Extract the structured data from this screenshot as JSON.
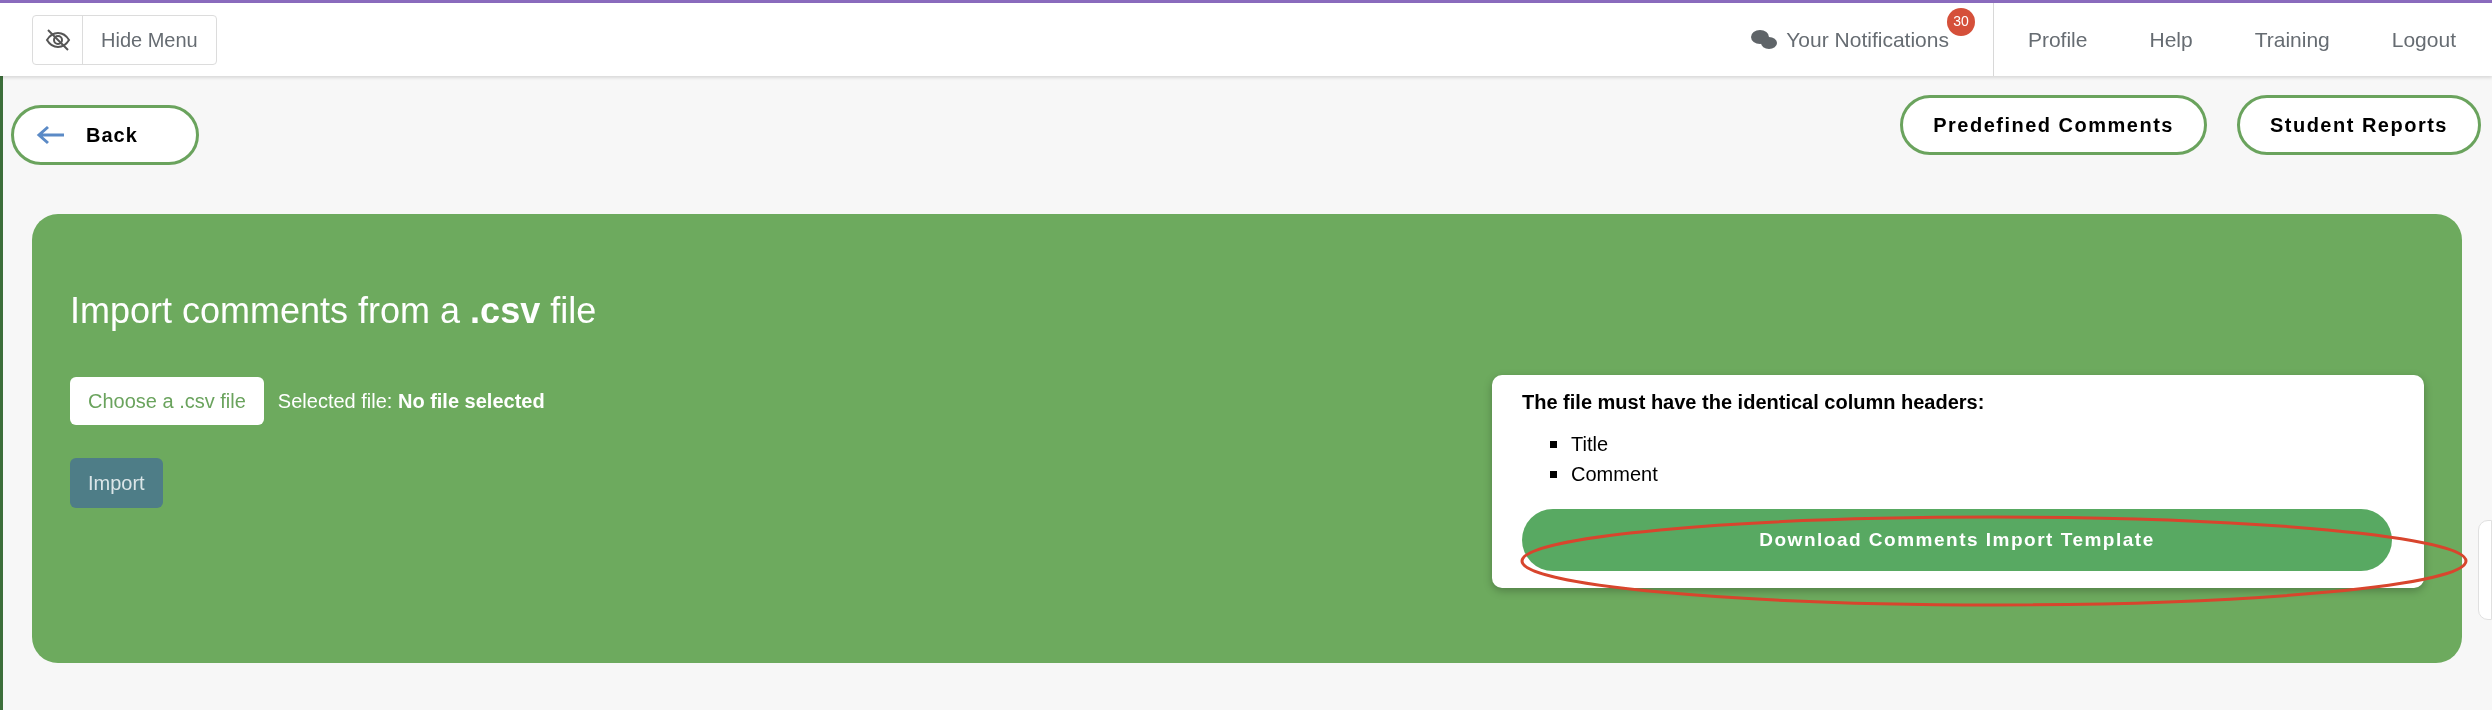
{
  "header": {
    "hide_menu": "Hide Menu",
    "notifications": {
      "label": "Your Notifications",
      "count": "30"
    },
    "nav": [
      "Profile",
      "Help",
      "Training",
      "Logout"
    ]
  },
  "back": "Back",
  "actions": [
    "Predefined Comments",
    "Student Reports"
  ],
  "import": {
    "title": "Import comments from a **.csv** file",
    "choose": "Choose a .csv file",
    "selected": "Selected file: **No file selected**",
    "import_button": "Import"
  },
  "template": {
    "heading": "The file must have the identical column headers:",
    "columns": [
      "Title",
      "Comment"
    ],
    "download": "Download Comments Import Template",
    "highlighted": true
  }
}
